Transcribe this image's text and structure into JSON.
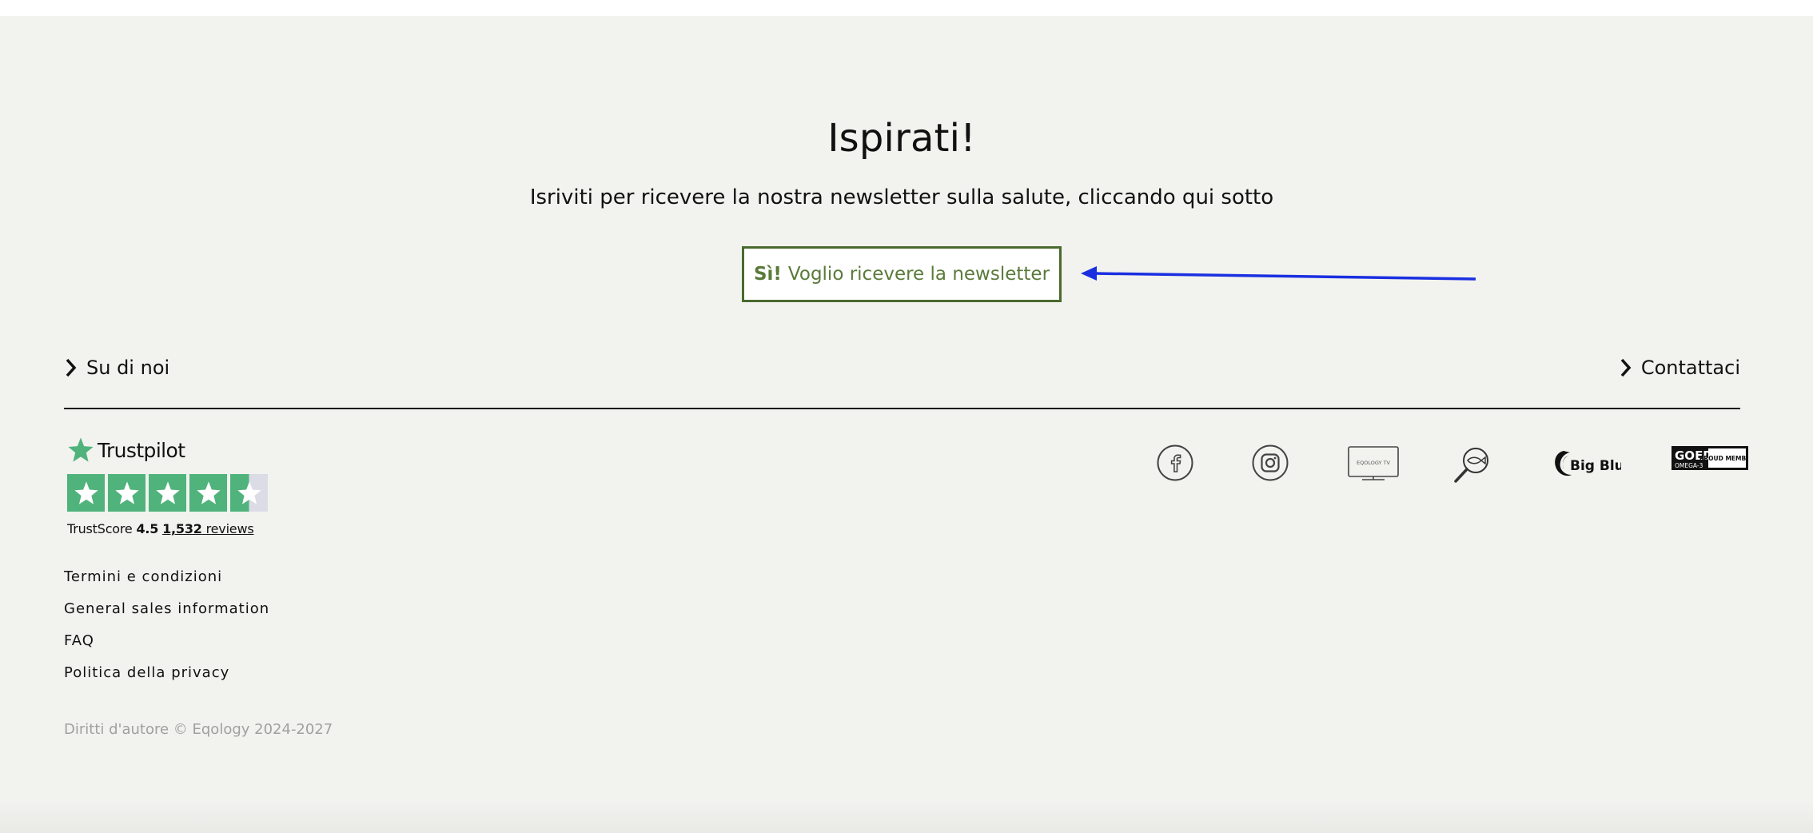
{
  "newsletter": {
    "title": "Ispirati!",
    "subtitle": "Isriviti per ricevere la nostra newsletter sulla salute, cliccando qui sotto",
    "button_strong": "Sì!",
    "button_text": "Voglio ricevere la newsletter"
  },
  "footer": {
    "about_label": "Su di noi",
    "contact_label": "Contattaci",
    "trustpilot": {
      "brand": "Trustpilot",
      "score_label": "TrustScore",
      "score": "4.5",
      "reviews_count": "1,532",
      "reviews_label": "reviews",
      "rating": 4.5,
      "star_color": "#4fb37b"
    },
    "links": [
      "Termini e condizioni",
      "General sales information",
      "FAQ",
      "Politica della privacy"
    ],
    "copyright": "Diritti d'autore © Eqology 2024-2027",
    "social_icons": [
      "facebook-icon",
      "instagram-icon",
      "eqology-tv-icon",
      "fish-magnifier-icon",
      "big-blue-logo",
      "goed-omega3-logo"
    ],
    "logo_texts": {
      "big_blue": "Big Blue",
      "goed": "GOED",
      "omega": "OMEGA-3",
      "proud_member": "PROUD MEMBER",
      "tv": "EQOLOGY TV"
    }
  },
  "colors": {
    "accent": "#4a6a2e",
    "arrow": "#1a2fe0",
    "background": "#f2f2ef"
  }
}
